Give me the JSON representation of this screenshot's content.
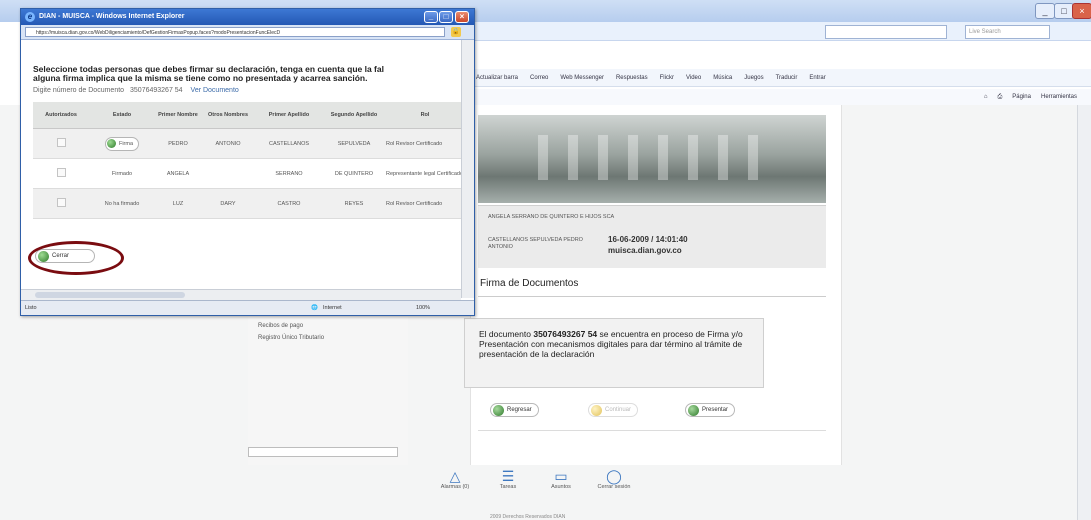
{
  "bg_window": {
    "search_placeholder": "Live Search"
  },
  "bg_toolbar": {
    "items": [
      "Actualizar barra",
      "Correo",
      "Web Messenger",
      "Respuestas",
      "Flickr",
      "Video",
      "Música",
      "Juegos",
      "Traducir",
      "Entrar"
    ]
  },
  "bg_commandbar": {
    "items": [
      "Página",
      "Herramientas"
    ]
  },
  "popup": {
    "title": "DIAN - MUISCA - Windows Internet Explorer",
    "url": "https://muisca.dian.gov.co/WebDiligenciamiento/DefGestionFirmasPopup.faces?modoPresentacionFuncElecD",
    "instruction_line1": "Seleccione todas personas que debes firmar su declaración, tenga en cuenta que la fal",
    "instruction_line2": "alguna firma implica que la misma se tiene como no presentada y acarrea sanción.",
    "doc_label": "Digite número de Documento",
    "doc_number": "35076493267 54",
    "doc_link": "Ver Documento",
    "table": {
      "headers": [
        "Autorizados",
        "Estado",
        "Primer Nombre",
        "Otros Nombres",
        "Primer Apellido",
        "Segundo Apellido",
        "Rol"
      ],
      "rows": [
        {
          "estado": "Firma",
          "primer_nombre": "PEDRO",
          "otros_nombres": "ANTONIO",
          "primer_apellido": "CASTELLANOS",
          "segundo_apellido": "SEPULVEDA",
          "rol": "Rol Revisor Certificado"
        },
        {
          "estado": "Firmado",
          "primer_nombre": "ANGELA",
          "otros_nombres": "",
          "primer_apellido": "SERRANO",
          "segundo_apellido": "DE QUINTERO",
          "rol": "Representante legal Certificado"
        },
        {
          "estado": "No ha firmado",
          "primer_nombre": "LUZ",
          "otros_nombres": "DARY",
          "primer_apellido": "CASTRO",
          "segundo_apellido": "REYES",
          "rol": "Rol Revisor Certificado"
        }
      ]
    },
    "close_button": "Cerrar",
    "status_left": "Listo",
    "status_zone": "Internet",
    "status_zoom": "100%"
  },
  "page": {
    "info_names": "ANGELA SERRANO DE QUINTERO E HIJOS SCA",
    "info_person": "CASTELLANOS SEPULVEDA PEDRO ANTONIO",
    "info_datetime": "16-06-2009 / 14:01:40",
    "info_site": "muisca.dian.gov.co",
    "section_title": "Firma de Documentos",
    "message_prefix": "El documento ",
    "message_doc": "35076493267 54",
    "message_suffix": " se encuentra en proceso de Firma y/o Presentación con mecanismos digitales para dar término al trámite de presentación de la declaración",
    "btn_back": "Regresar",
    "btn_mid": "Continuar",
    "btn_next": "Presentar",
    "side_links": [
      "Recibos de pago",
      "Registro Único Tributario"
    ],
    "footer": [
      {
        "label": "Alarmas (0)",
        "icon": "alarm-icon"
      },
      {
        "label": "Tareas",
        "icon": "tasks-icon"
      },
      {
        "label": "Asuntos",
        "icon": "folder-icon"
      },
      {
        "label": "Cerrar sesión",
        "icon": "power-icon"
      }
    ],
    "footer_copy": "2009 Derechos Reservados DIAN"
  }
}
